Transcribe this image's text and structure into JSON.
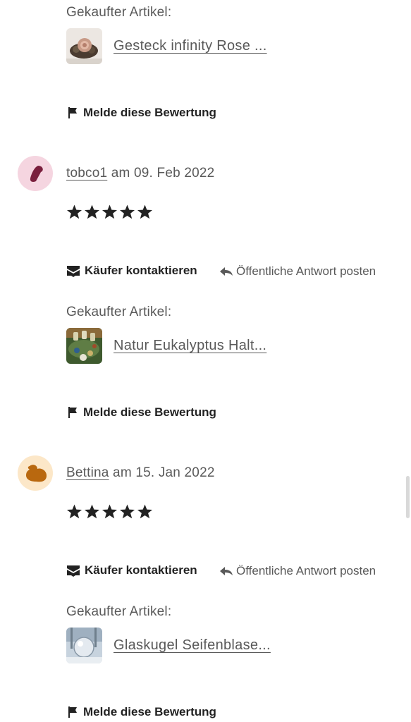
{
  "purchased_label": "Gekaufter Artikel:",
  "report_label": "Melde diese Bewertung",
  "contact_label": "Käufer kontaktieren",
  "reply_label": "Öffentliche Antwort posten",
  "date_prefix": "am",
  "reviews": [
    {
      "item_title": "Gesteck infinity Rose ..."
    },
    {
      "reviewer": "tobco1",
      "date": "09. Feb 2022",
      "rating": 5,
      "avatar_color": "#f5d5e0",
      "avatar_icon_color": "#7a1f3d",
      "item_title": "Natur Eukalyptus Halt..."
    },
    {
      "reviewer": "Bettina",
      "date": "15. Jan 2022",
      "rating": 5,
      "avatar_color": "#fce7c8",
      "avatar_icon_color": "#b9680f",
      "item_title": "Glaskugel Seifenblase..."
    }
  ],
  "colors": {
    "text": "#222222",
    "muted": "#595959",
    "background": "#ffffff"
  }
}
